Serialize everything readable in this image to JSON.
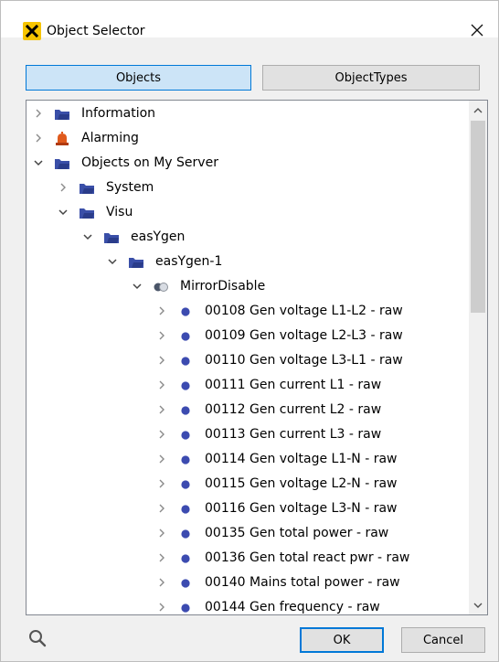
{
  "window": {
    "title": "Object Selector",
    "close_symbol": "✕"
  },
  "tabs": [
    {
      "label": "Objects",
      "active": true
    },
    {
      "label": "ObjectTypes",
      "active": false
    }
  ],
  "tree": {
    "nodes": [
      {
        "label": "Information",
        "depth": 0,
        "expander": "collapsed",
        "icon": "folder-icon"
      },
      {
        "label": "Alarming",
        "depth": 0,
        "expander": "collapsed",
        "icon": "alarm-bell-icon"
      },
      {
        "label": "Objects on My Server",
        "depth": 0,
        "expander": "expanded",
        "icon": "folder-icon"
      },
      {
        "label": "System",
        "depth": 1,
        "expander": "collapsed",
        "icon": "folder-icon"
      },
      {
        "label": "Visu",
        "depth": 1,
        "expander": "expanded",
        "icon": "folder-icon"
      },
      {
        "label": "easYgen",
        "depth": 2,
        "expander": "expanded",
        "icon": "folder-icon"
      },
      {
        "label": "easYgen-1",
        "depth": 3,
        "expander": "expanded",
        "icon": "folder-icon"
      },
      {
        "label": "MirrorDisable",
        "depth": 4,
        "expander": "expanded",
        "icon": "object-link-icon"
      },
      {
        "label": "00108 Gen voltage L1-L2 - raw",
        "depth": 5,
        "expander": "collapsed",
        "icon": "variable-dot-icon"
      },
      {
        "label": "00109 Gen voltage L2-L3 - raw",
        "depth": 5,
        "expander": "collapsed",
        "icon": "variable-dot-icon"
      },
      {
        "label": "00110 Gen voltage L3-L1 - raw",
        "depth": 5,
        "expander": "collapsed",
        "icon": "variable-dot-icon"
      },
      {
        "label": "00111 Gen current L1 - raw",
        "depth": 5,
        "expander": "collapsed",
        "icon": "variable-dot-icon"
      },
      {
        "label": "00112 Gen current L2 - raw",
        "depth": 5,
        "expander": "collapsed",
        "icon": "variable-dot-icon"
      },
      {
        "label": "00113 Gen current L3 - raw",
        "depth": 5,
        "expander": "collapsed",
        "icon": "variable-dot-icon"
      },
      {
        "label": "00114 Gen voltage L1-N - raw",
        "depth": 5,
        "expander": "collapsed",
        "icon": "variable-dot-icon"
      },
      {
        "label": "00115 Gen voltage L2-N - raw",
        "depth": 5,
        "expander": "collapsed",
        "icon": "variable-dot-icon"
      },
      {
        "label": "00116 Gen voltage L3-N - raw",
        "depth": 5,
        "expander": "collapsed",
        "icon": "variable-dot-icon"
      },
      {
        "label": "00135 Gen total power - raw",
        "depth": 5,
        "expander": "collapsed",
        "icon": "variable-dot-icon"
      },
      {
        "label": "00136 Gen total react pwr - raw",
        "depth": 5,
        "expander": "collapsed",
        "icon": "variable-dot-icon"
      },
      {
        "label": "00140 Mains total power - raw",
        "depth": 5,
        "expander": "collapsed",
        "icon": "variable-dot-icon"
      },
      {
        "label": "00144 Gen frequency - raw",
        "depth": 5,
        "expander": "collapsed",
        "icon": "variable-dot-icon"
      }
    ]
  },
  "footer": {
    "ok_label": "OK",
    "cancel_label": "Cancel"
  },
  "colors": {
    "folder": "#3a4fa8",
    "variable_dot": "#3c4bb0",
    "alarm": "#e05a1c",
    "accent": "#0078d7",
    "tab_active_bg": "#cce4f7"
  }
}
